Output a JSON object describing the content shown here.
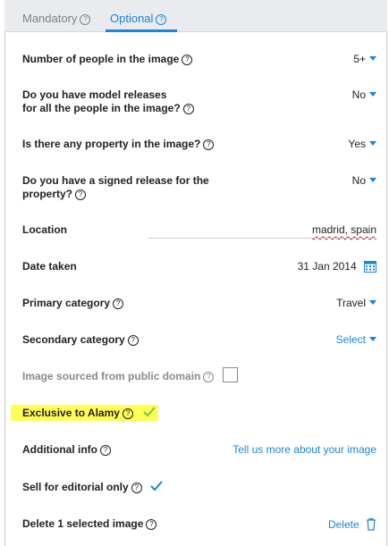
{
  "tabs": [
    {
      "label": "Mandatory"
    },
    {
      "label": "Optional"
    }
  ],
  "active_tab": "Optional",
  "fields": {
    "people": {
      "label": "Number of people in the image",
      "value": "5+"
    },
    "model_releases": {
      "label_line1": "Do you have model releases",
      "label_line2": "for all the people in the image?",
      "value": "No"
    },
    "property": {
      "label": "Is there any property in the image?",
      "value": "Yes"
    },
    "property_release": {
      "label_line1": "Do you have a signed release for the",
      "label_line2": "property?",
      "value": "No"
    },
    "location": {
      "label": "Location",
      "value": "madrid, spain"
    },
    "date_taken": {
      "label": "Date taken",
      "value": "31 Jan 2014"
    },
    "primary_category": {
      "label": "Primary category",
      "value": "Travel"
    },
    "secondary_category": {
      "label": "Secondary category",
      "value": "Select"
    },
    "public_domain": {
      "label": "Image sourced from public domain",
      "checked": false
    },
    "exclusive": {
      "label": "Exclusive to Alamy",
      "checked": true
    },
    "additional_info": {
      "label": "Additional info",
      "link": "Tell us more about your image"
    },
    "editorial": {
      "label": "Sell for editorial only",
      "checked": true
    },
    "delete": {
      "label": "Delete 1 selected image",
      "action": "Delete"
    }
  },
  "icons": {
    "help": "question-circle-icon",
    "dropdown": "caret-down-icon",
    "calendar": "calendar-icon",
    "check": "checkmark-icon",
    "trash": "trash-icon"
  },
  "colors": {
    "accent": "#1a86d6",
    "check_green": "#7cc44a",
    "highlight": "#ffff55",
    "tab_bar": "#e9ebee"
  }
}
